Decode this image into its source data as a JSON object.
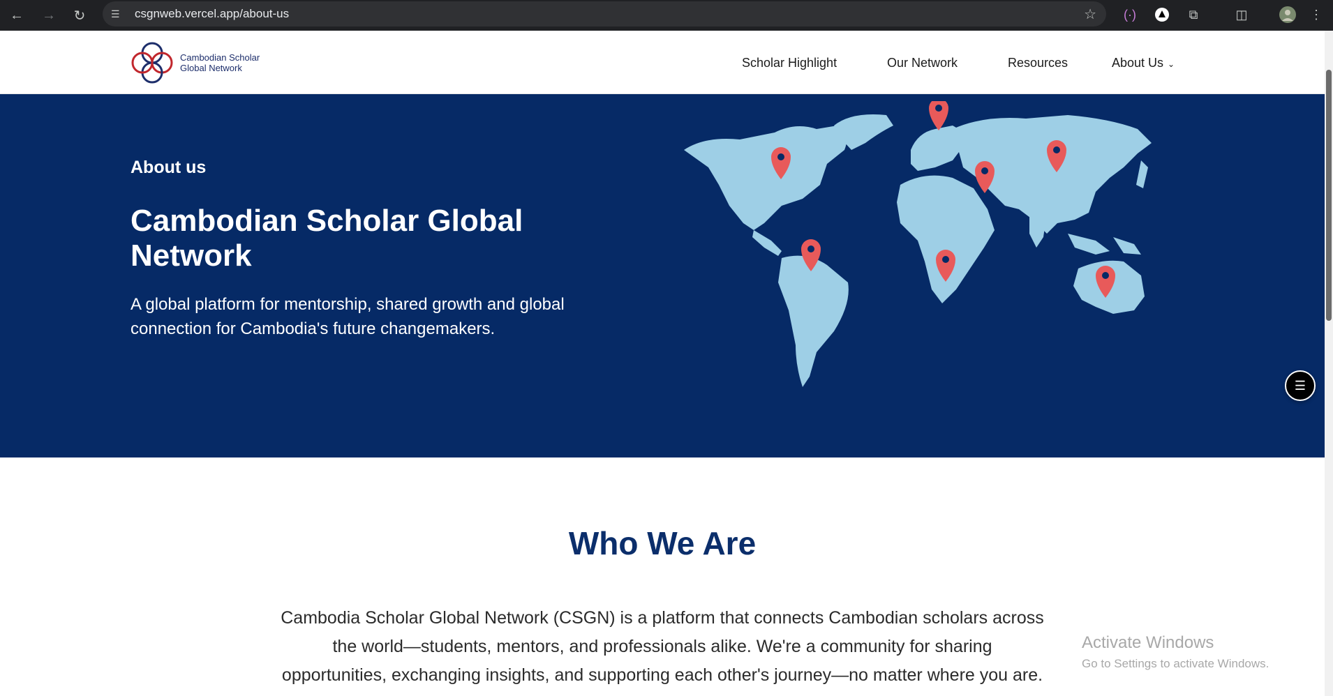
{
  "browser": {
    "url": "csgnweb.vercel.app/about-us",
    "back_icon": "arrow-left-icon",
    "forward_icon": "arrow-right-icon",
    "reload_icon": "reload-icon"
  },
  "site": {
    "logo_line1": "Cambodian Scholar",
    "logo_line2": "Global Network",
    "nav": [
      {
        "label": "Scholar Highlight"
      },
      {
        "label": "Our Network"
      },
      {
        "label": "Resources"
      },
      {
        "label": "About Us"
      }
    ]
  },
  "hero": {
    "eyebrow": "About us",
    "title": "Cambodian Scholar Global Network",
    "description": "A global platform for mentorship, shared growth and global connection for Cambodia's future changemakers."
  },
  "who_we_are": {
    "title": "Who We Are",
    "body": "Cambodia Scholar Global Network (CSGN) is a platform that connects Cambodian scholars across the world—students, mentors, and professionals alike. We're a community for sharing opportunities, exchanging insights, and supporting each other's journey—no matter where you are."
  },
  "watermark": {
    "line1": "Activate Windows",
    "line2": "Go to Settings to activate Windows."
  },
  "colors": {
    "hero_bg": "#062a66",
    "map_land": "#9ecfe6",
    "pin": "#e85a5a",
    "heading": "#0b2e6b"
  }
}
